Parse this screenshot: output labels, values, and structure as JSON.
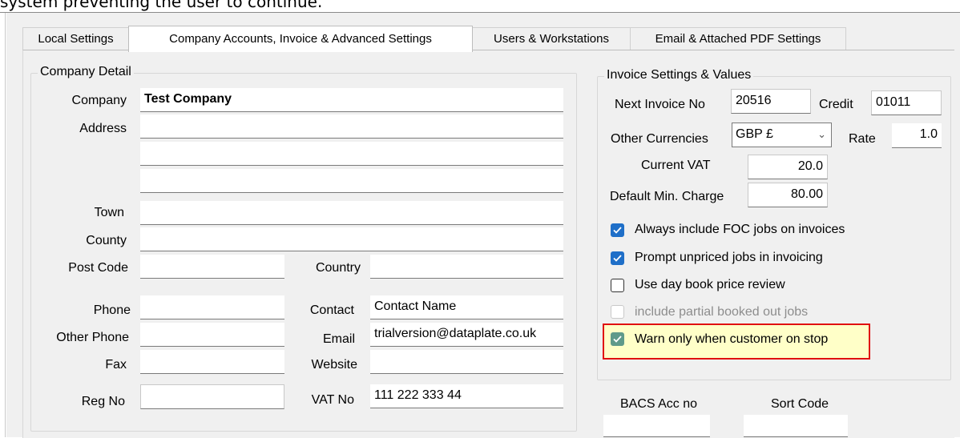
{
  "caption": "system preventing the user to continue.",
  "tabs": [
    {
      "label": "Local Settings"
    },
    {
      "label": "Company Accounts, Invoice & Advanced Settings"
    },
    {
      "label": "Users & Workstations"
    },
    {
      "label": "Email & Attached PDF Settings"
    }
  ],
  "company_detail": {
    "title": "Company Detail",
    "company_label": "Company",
    "company_value": "Test Company",
    "address_label": "Address",
    "address_lines": [
      "",
      "",
      ""
    ],
    "town_label": "Town",
    "town_value": "",
    "county_label": "County",
    "county_value": "",
    "postcode_label": "Post Code",
    "postcode_value": "",
    "country_label": "Country",
    "country_value": "",
    "phone_label": "Phone",
    "phone_value": "",
    "otherphone_label": "Other Phone",
    "otherphone_value": "",
    "fax_label": "Fax",
    "fax_value": "",
    "regno_label": "Reg No",
    "regno_value": "",
    "contact_label": "Contact",
    "contact_value": "Contact Name",
    "email_label": "Email",
    "email_value": "trialversion@dataplate.co.uk",
    "website_label": "Website",
    "website_value": "",
    "vatno_label": "VAT No",
    "vatno_value": "111 222 333 44"
  },
  "invoice_settings": {
    "title": "Invoice Settings & Values",
    "next_invoice_label": "Next Invoice No",
    "next_invoice_value": "20516",
    "credit_label": "Credit",
    "credit_value": "01011",
    "other_currencies_label": "Other Currencies",
    "currency_selected": "GBP £",
    "rate_label": "Rate",
    "rate_value": "1.0",
    "current_vat_label": "Current VAT",
    "current_vat_value": "20.0",
    "min_charge_label": "Default Min. Charge",
    "min_charge_value": "80.00",
    "checkboxes": [
      {
        "label": "Always include FOC jobs on invoices",
        "checked": true,
        "enabled": true
      },
      {
        "label": "Prompt unpriced jobs in invoicing",
        "checked": true,
        "enabled": true
      },
      {
        "label": "Use day book price review",
        "checked": false,
        "enabled": true
      },
      {
        "label": "include partial booked out jobs",
        "checked": false,
        "enabled": false
      },
      {
        "label": "Warn only when customer on stop",
        "checked": true,
        "enabled": true,
        "highlighted": true
      }
    ]
  },
  "bank": {
    "bacs_label": "BACS Acc no",
    "sort_code_label": "Sort Code",
    "bacs_value": "",
    "sort_code_value": ""
  },
  "colors": {
    "checkbox_checked": "#1f6fc8",
    "highlight_border": "#e01010",
    "highlight_fill": "#ffffc8",
    "dialog_bg": "#f0f0f0"
  }
}
